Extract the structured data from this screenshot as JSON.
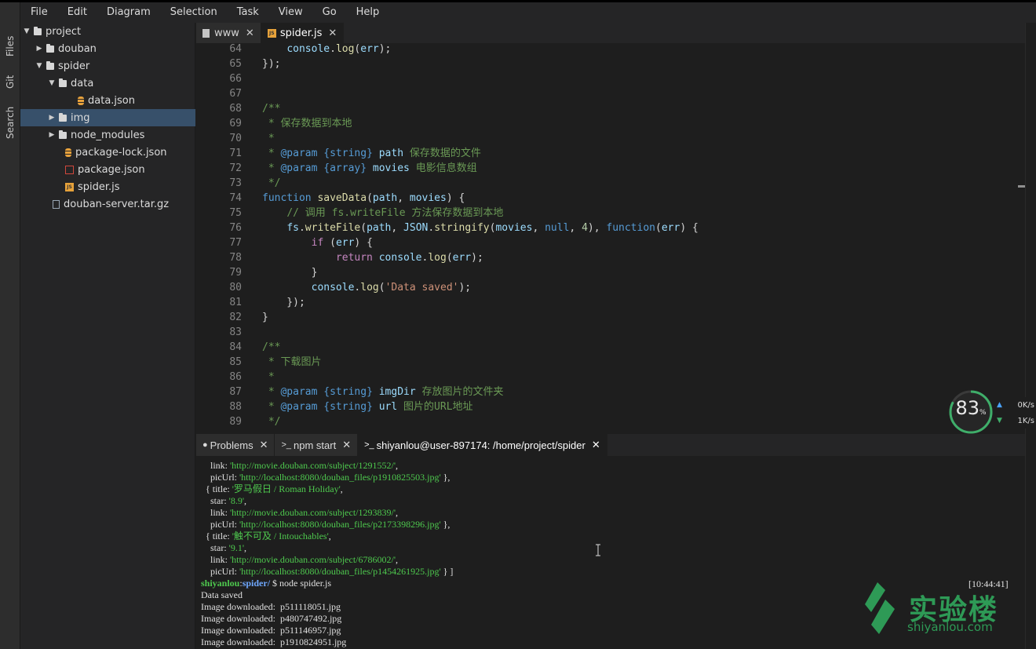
{
  "menu": [
    "File",
    "Edit",
    "Diagram",
    "Selection",
    "Task",
    "View",
    "Go",
    "Help"
  ],
  "activity": {
    "files": "Files",
    "git": "Git",
    "search": "Search"
  },
  "tree": [
    {
      "label": "project",
      "twisty": "▼",
      "icon": "folder"
    },
    {
      "label": "douban",
      "twisty": "▶",
      "icon": "folder"
    },
    {
      "label": "spider",
      "twisty": "▼",
      "icon": "folder"
    },
    {
      "label": "data",
      "twisty": "▼",
      "icon": "folder"
    },
    {
      "label": "data.json",
      "twisty": "",
      "icon": "database"
    },
    {
      "label": "img",
      "twisty": "▶",
      "icon": "folder",
      "selected": true
    },
    {
      "label": "node_modules",
      "twisty": "▶",
      "icon": "folder"
    },
    {
      "label": "package-lock.json",
      "twisty": "",
      "icon": "database"
    },
    {
      "label": "package.json",
      "twisty": "",
      "icon": "package"
    },
    {
      "label": "spider.js",
      "twisty": "",
      "icon": "javascript"
    },
    {
      "label": "douban-server.tar.gz",
      "twisty": "",
      "icon": "file"
    }
  ],
  "tabs": [
    {
      "label": "www",
      "close": "✕",
      "icon": "file-icon"
    },
    {
      "label": "spider.js",
      "close": "✕",
      "icon": "js-icon",
      "active": true
    }
  ],
  "js_badge": "JS",
  "editor_lines": [
    {
      "n": "64",
      "html": "    <span class='vr'>console</span>.<span class='fn'>log</span>(<span class='vr'>err</span>);"
    },
    {
      "n": "65",
      "html": "});"
    },
    {
      "n": "66",
      "html": ""
    },
    {
      "n": "67",
      "html": ""
    },
    {
      "n": "68",
      "html": "<span class='cm'>/**</span>"
    },
    {
      "n": "69",
      "html": "<span class='cm'> * 保存数据到本地</span>"
    },
    {
      "n": "70",
      "html": "<span class='cm'> *</span>"
    },
    {
      "n": "71",
      "html": "<span class='cm'> * </span><span class='bl'>@param</span><span class='cm'> </span><span class='bl'>{string}</span><span class='cm'> </span><span class='vr'>path</span><span class='cm'> 保存数据的文件</span>"
    },
    {
      "n": "72",
      "html": "<span class='cm'> * </span><span class='bl'>@param</span><span class='cm'> </span><span class='bl'>{array}</span><span class='cm'> </span><span class='vr'>movies</span><span class='cm'> 电影信息数组</span>"
    },
    {
      "n": "73",
      "html": "<span class='cm'> */</span>"
    },
    {
      "n": "74",
      "html": "<span class='bl'>function</span> <span class='fn'>saveData</span>(<span class='vr'>path</span>, <span class='vr'>movies</span>) {"
    },
    {
      "n": "75",
      "html": "    <span class='cm'>// 调用 fs.writeFile 方法保存数据到本地</span>"
    },
    {
      "n": "76",
      "html": "    <span class='vr'>fs</span>.<span class='fn'>writeFile</span>(<span class='vr'>path</span>, <span class='vr'>JSON</span>.<span class='fn'>stringify</span>(<span class='vr'>movies</span>, <span class='bl'>null</span>, <span class='nm'>4</span>), <span class='bl'>function</span>(<span class='vr'>err</span>) {"
    },
    {
      "n": "77",
      "html": "        <span class='kw'>if</span> (<span class='vr'>err</span>) {"
    },
    {
      "n": "78",
      "html": "            <span class='kw'>return</span> <span class='vr'>console</span>.<span class='fn'>log</span>(<span class='vr'>err</span>);"
    },
    {
      "n": "79",
      "html": "        }"
    },
    {
      "n": "80",
      "html": "        <span class='vr'>console</span>.<span class='fn'>log</span>(<span class='st'>'Data saved'</span>);"
    },
    {
      "n": "81",
      "html": "    });"
    },
    {
      "n": "82",
      "html": "}"
    },
    {
      "n": "83",
      "html": ""
    },
    {
      "n": "84",
      "html": "<span class='cm'>/**</span>"
    },
    {
      "n": "85",
      "html": "<span class='cm'> * 下载图片</span>"
    },
    {
      "n": "86",
      "html": "<span class='cm'> *</span>"
    },
    {
      "n": "87",
      "html": "<span class='cm'> * </span><span class='bl'>@param</span><span class='cm'> </span><span class='bl'>{string}</span><span class='cm'> </span><span class='vr'>imgDir</span><span class='cm'> 存放图片的文件夹</span>"
    },
    {
      "n": "88",
      "html": "<span class='cm'> * </span><span class='bl'>@param</span><span class='cm'> </span><span class='bl'>{string}</span><span class='cm'> </span><span class='vr'>url</span><span class='cm'> 图片的URL地址</span>"
    },
    {
      "n": "89",
      "html": "<span class='cm'> */</span>"
    }
  ],
  "gauge": {
    "value": "83",
    "unit": "%"
  },
  "net": {
    "up": "0K/s",
    "down": "1K/s",
    "up_arrow": "▲",
    "down_arrow": "▼"
  },
  "panel_tabs": [
    {
      "label": "Problems",
      "prefix": "●",
      "close": "✕"
    },
    {
      "label": "npm start",
      "prefix": ">_",
      "close": "✕"
    },
    {
      "label": "shiyanlou@user-897174: /home/project/spider",
      "prefix": ">_",
      "close": "✕",
      "active": true
    }
  ],
  "terminal_lines": [
    {
      "html": "    link: <span class='tg'>'http://movie.douban.com/subject/1291552/'</span>,"
    },
    {
      "html": "    picUrl: <span class='tg'>'http://localhost:8080/douban_files/p1910825503.jpg'</span> },"
    },
    {
      "html": "  { title: <span class='tg'>'罗马假日 / Roman Holiday'</span>,"
    },
    {
      "html": "    star: <span class='tg'>'8.9'</span>,"
    },
    {
      "html": "    link: <span class='tg'>'http://movie.douban.com/subject/1293839/'</span>,"
    },
    {
      "html": "    picUrl: <span class='tg'>'http://localhost:8080/douban_files/p2173398296.jpg'</span> },"
    },
    {
      "html": "  { title: <span class='tg'>'触不可及 / Intouchables'</span>,"
    },
    {
      "html": "    star: <span class='tg'>'9.1'</span>,"
    },
    {
      "html": "    link: <span class='tg'>'http://movie.douban.com/subject/6786002/'</span>,"
    },
    {
      "html": "    picUrl: <span class='tg'>'http://localhost:8080/douban_files/p1454261925.jpg'</span> } ]"
    },
    {
      "html": "<span class='tp'>shiyanlou</span>:<span class='tb'>spider/</span> $ node spider.js"
    },
    {
      "html": "Data saved"
    },
    {
      "html": "Image downloaded:  p511118051.jpg"
    },
    {
      "html": "Image downloaded:  p480747492.jpg"
    },
    {
      "html": "Image downloaded:  p511146957.jpg"
    },
    {
      "html": "Image downloaded:  p1910824951.jpg"
    }
  ],
  "terminal_time": "[10:44:41]",
  "watermark": {
    "text": "实验楼",
    "sub": "shiyanlou.com"
  },
  "colors": {
    "accent": "#37506a",
    "brand": "#2e9a56"
  }
}
